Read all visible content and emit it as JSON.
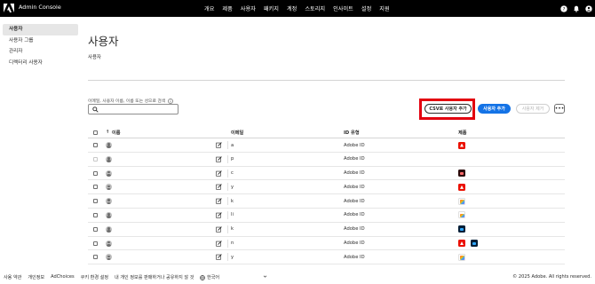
{
  "app": {
    "title": "Admin Console",
    "accent": "#1473e6",
    "highlight": "#e3000f"
  },
  "topnav": [
    {
      "label": "개요"
    },
    {
      "label": "제품"
    },
    {
      "label": "사용자",
      "active": true
    },
    {
      "label": "패키지"
    },
    {
      "label": "계정"
    },
    {
      "label": "스토리지"
    },
    {
      "label": "인사이트"
    },
    {
      "label": "설정"
    },
    {
      "label": "지원"
    }
  ],
  "top_icons": [
    "help-icon",
    "bell-icon",
    "user-icon"
  ],
  "sidebar": {
    "items": [
      {
        "label": "사용자",
        "active": true
      },
      {
        "label": "사용자 그룹"
      },
      {
        "label": "관리자"
      },
      {
        "label": "디렉터리 사용자"
      }
    ]
  },
  "main": {
    "title": "사용자",
    "subtab": "사용자",
    "search": {
      "label": "이메일, 사용자 이름, 이름 또는 성으로 검색",
      "value": ""
    },
    "buttons": {
      "csv": "CSV로 사용자 추가",
      "add": "사용자 추가",
      "remove": "사용자 제거",
      "more": "•••"
    },
    "table": {
      "headers": {
        "name": "이름",
        "sort_arrow": "↑",
        "email": "이메일",
        "idtype": "ID 유형",
        "products": "제품"
      },
      "rows": [
        {
          "email": "a",
          "idtype": "Adobe ID",
          "products": [
            "red"
          ]
        },
        {
          "email": "p",
          "idtype": "Adobe ID",
          "products": []
        },
        {
          "email": "c",
          "idtype": "Adobe ID",
          "products": [
            "dark"
          ]
        },
        {
          "email": "y",
          "idtype": "Adobe ID",
          "products": [
            "red"
          ]
        },
        {
          "email": "k",
          "idtype": "Adobe ID",
          "products": [
            "cc"
          ]
        },
        {
          "email": "li",
          "idtype": "Adobe ID",
          "products": [
            "cc"
          ]
        },
        {
          "email": "k",
          "idtype": "Adobe ID",
          "products": [
            "navy"
          ]
        },
        {
          "email": "n",
          "idtype": "Adobe ID",
          "products": [
            "red",
            "navy"
          ]
        },
        {
          "email": "y",
          "idtype": "Adobe ID",
          "products": [
            "cc"
          ]
        }
      ]
    }
  },
  "footer": {
    "links": [
      "사용 약관",
      "개인정보",
      "AdChoices",
      "쿠키 환경 설정",
      "내 개인 정보를 판매하거나 공유하지 않 것"
    ],
    "language": "한국어",
    "copyright": "© 2025 Adobe. All rights reserved."
  }
}
